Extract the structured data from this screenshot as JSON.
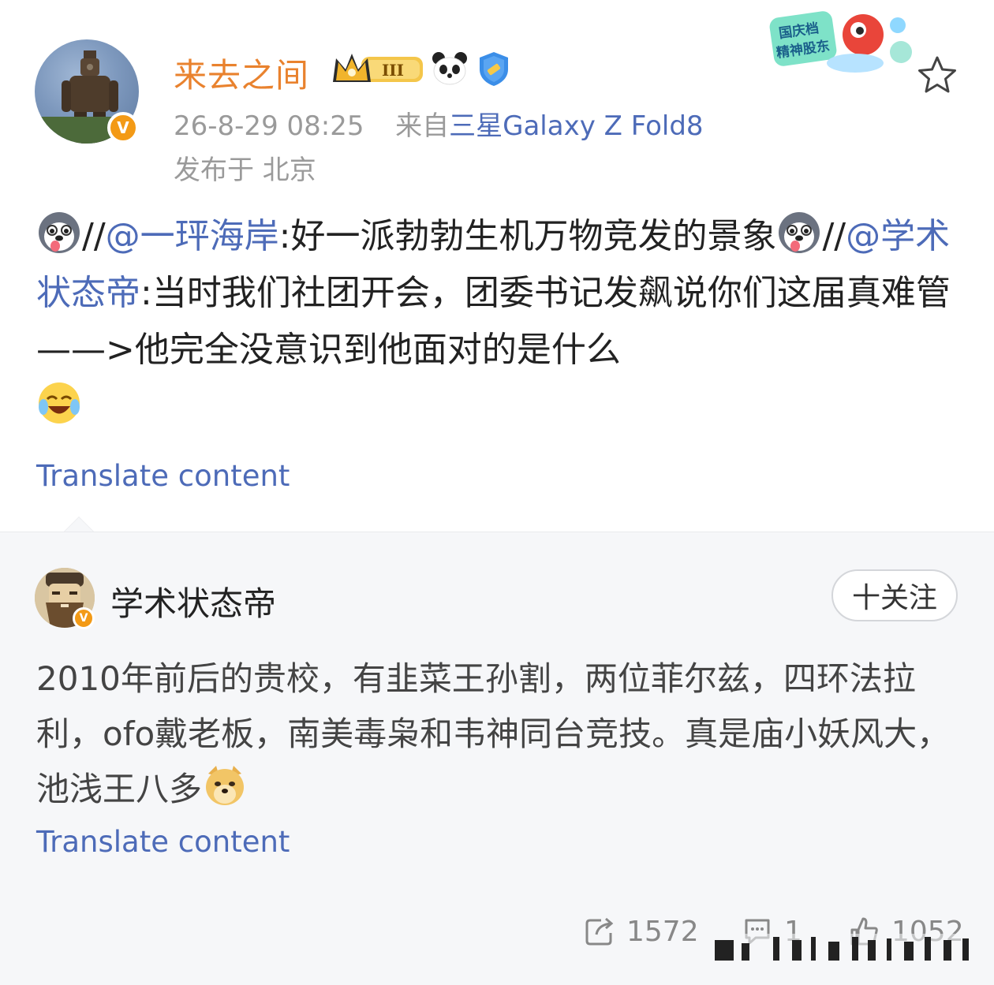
{
  "post": {
    "username": "来去之间",
    "level_badge_text": "III",
    "timestamp": "26-8-29 08:25",
    "source_prefix": "来自",
    "device": "三星Galaxy Z Fold8",
    "location": "发布于 北京",
    "promo_sticker_text": [
      "国庆档",
      "精神股东"
    ],
    "body": {
      "seg1": "//",
      "mention1": "@一玶海岸",
      "seg2": ":好一派勃勃生机万物竞发的景象",
      "seg3": "//",
      "mention2": "@学术状态帝",
      "seg4": ":当时我们社团开会，团委书记发飙说你们这届真难管——>他完全没意识到他面对的是什么"
    },
    "translate_label": "Translate content"
  },
  "repost": {
    "username": "学术状态帝",
    "follow_label": "十关注",
    "body": "2010年前后的贵校，有韭菜王孙割，两位菲尔兹，四环法拉利，ofo戴老板，南美毒枭和韦神同台竞技。真是庙小妖风大，池浅王八多",
    "translate_label": "Translate content"
  },
  "actions": {
    "repost_count": "1572",
    "comment_count": "1",
    "like_count": "1052"
  },
  "icons": {
    "verified": "verified-v-icon",
    "crown": "crown-badge-icon",
    "panda": "panda-badge-icon",
    "shield": "shield-badge-icon",
    "star": "favorite-star-icon",
    "share": "repost-icon",
    "comment": "comment-icon",
    "like": "like-icon",
    "husky": "husky-emoji-icon",
    "laugh": "laugh-cry-emoji-icon",
    "doge": "doge-emoji-icon"
  },
  "colors": {
    "username_orange": "#e9822e",
    "link_blue": "#4d6bb8",
    "meta_gray": "#9a9a9a",
    "card_bg": "#f6f7f9",
    "verified_orange": "#f39a16"
  }
}
